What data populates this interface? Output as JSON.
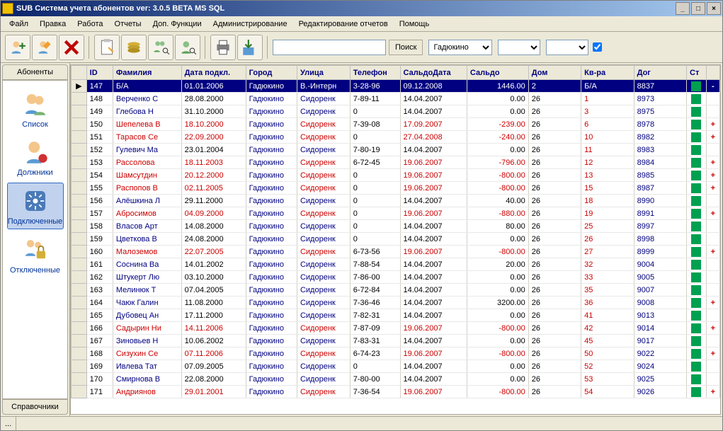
{
  "title": "SUB Система учета абонентов ver: 3.0.5 BETA MS SQL",
  "menu": [
    "Файл",
    "Правка",
    "Работа",
    "Отчеты",
    "Доп. Функции",
    "Администрирование",
    "Редактирование отчетов",
    "Помощь"
  ],
  "toolbar": {
    "search_btn": "Поиск",
    "combo1": "Гадюкино"
  },
  "sidebar": {
    "header": "Абоненты",
    "footer": "Справочники",
    "items": [
      {
        "label": "Список"
      },
      {
        "label": "Должники"
      },
      {
        "label": "Подключенные"
      },
      {
        "label": "Отключенные"
      }
    ]
  },
  "grid": {
    "headers": [
      "ID",
      "Фамилия",
      "Дата подкл.",
      "Город",
      "Улица",
      "Телефон",
      "СальдоДата",
      "Сальдо",
      "Дом",
      "Кв-ра",
      "Дог",
      "Ст"
    ],
    "rows": [
      {
        "id": "147",
        "fam": "Б/А",
        "date": "01.01.2006",
        "city": "Гадюкино",
        "street": "В.-Интерн",
        "phone": "3-28-96",
        "sdate": "09.12.2008",
        "saldo": "1446.00",
        "house": "2",
        "flat": "Б/А",
        "dog": "8837",
        "neg": false,
        "flag": "-",
        "sel": true
      },
      {
        "id": "148",
        "fam": "Верченко С",
        "date": "28.08.2000",
        "city": "Гадюкино",
        "street": "Сидоренк",
        "phone": "7-89-11",
        "sdate": "14.04.2007",
        "saldo": "0.00",
        "house": "26",
        "flat": "1",
        "dog": "8973",
        "neg": false,
        "flag": ""
      },
      {
        "id": "149",
        "fam": "Глебова Н",
        "date": "31.10.2000",
        "city": "Гадюкино",
        "street": "Сидоренк",
        "phone": "0",
        "sdate": "14.04.2007",
        "saldo": "0.00",
        "house": "26",
        "flat": "3",
        "dog": "8975",
        "neg": false,
        "flag": ""
      },
      {
        "id": "150",
        "fam": "Шепелева В",
        "date": "18.10.2000",
        "city": "Гадюкино",
        "street": "Сидоренк",
        "phone": "7-39-08",
        "sdate": "17.09.2007",
        "saldo": "-239.00",
        "house": "26",
        "flat": "6",
        "dog": "8978",
        "neg": true,
        "flag": "+"
      },
      {
        "id": "151",
        "fam": "Тарасов Се",
        "date": "22.09.2000",
        "city": "Гадюкино",
        "street": "Сидоренк",
        "phone": "0",
        "sdate": "27.04.2008",
        "saldo": "-240.00",
        "house": "26",
        "flat": "10",
        "dog": "8982",
        "neg": true,
        "flag": "+"
      },
      {
        "id": "152",
        "fam": "Гулевич Ма",
        "date": "23.01.2004",
        "city": "Гадюкино",
        "street": "Сидоренк",
        "phone": "7-80-19",
        "sdate": "14.04.2007",
        "saldo": "0.00",
        "house": "26",
        "flat": "11",
        "dog": "8983",
        "neg": false,
        "flag": ""
      },
      {
        "id": "153",
        "fam": "Рассолова",
        "date": "18.11.2003",
        "city": "Гадюкино",
        "street": "Сидоренк",
        "phone": "6-72-45",
        "sdate": "19.06.2007",
        "saldo": "-796.00",
        "house": "26",
        "flat": "12",
        "dog": "8984",
        "neg": true,
        "flag": "+"
      },
      {
        "id": "154",
        "fam": "Шамсутдин",
        "date": "20.12.2000",
        "city": "Гадюкино",
        "street": "Сидоренк",
        "phone": "0",
        "sdate": "19.06.2007",
        "saldo": "-800.00",
        "house": "26",
        "flat": "13",
        "dog": "8985",
        "neg": true,
        "flag": "+"
      },
      {
        "id": "155",
        "fam": "Распопов В",
        "date": "02.11.2005",
        "city": "Гадюкино",
        "street": "Сидоренк",
        "phone": "0",
        "sdate": "19.06.2007",
        "saldo": "-800.00",
        "house": "26",
        "flat": "15",
        "dog": "8987",
        "neg": true,
        "flag": "+"
      },
      {
        "id": "156",
        "fam": "Алёшкина Л",
        "date": "29.11.2000",
        "city": "Гадюкино",
        "street": "Сидоренк",
        "phone": "0",
        "sdate": "14.04.2007",
        "saldo": "40.00",
        "house": "26",
        "flat": "18",
        "dog": "8990",
        "neg": false,
        "flag": ""
      },
      {
        "id": "157",
        "fam": "Абросимов",
        "date": "04.09.2000",
        "city": "Гадюкино",
        "street": "Сидоренк",
        "phone": "0",
        "sdate": "19.06.2007",
        "saldo": "-880.00",
        "house": "26",
        "flat": "19",
        "dog": "8991",
        "neg": true,
        "flag": "+"
      },
      {
        "id": "158",
        "fam": "Власов Арт",
        "date": "14.08.2000",
        "city": "Гадюкино",
        "street": "Сидоренк",
        "phone": "0",
        "sdate": "14.04.2007",
        "saldo": "80.00",
        "house": "26",
        "flat": "25",
        "dog": "8997",
        "neg": false,
        "flag": ""
      },
      {
        "id": "159",
        "fam": "Цветкова В",
        "date": "24.08.2000",
        "city": "Гадюкино",
        "street": "Сидоренк",
        "phone": "0",
        "sdate": "14.04.2007",
        "saldo": "0.00",
        "house": "26",
        "flat": "26",
        "dog": "8998",
        "neg": false,
        "flag": ""
      },
      {
        "id": "160",
        "fam": "Малоземов",
        "date": "22.07.2005",
        "city": "Гадюкино",
        "street": "Сидоренк",
        "phone": "6-73-56",
        "sdate": "19.06.2007",
        "saldo": "-800.00",
        "house": "26",
        "flat": "27",
        "dog": "8999",
        "neg": true,
        "flag": "+"
      },
      {
        "id": "161",
        "fam": "Соснина Ва",
        "date": "14.01.2002",
        "city": "Гадюкино",
        "street": "Сидоренк",
        "phone": "7-88-54",
        "sdate": "14.04.2007",
        "saldo": "20.00",
        "house": "26",
        "flat": "32",
        "dog": "9004",
        "neg": false,
        "flag": ""
      },
      {
        "id": "162",
        "fam": "Штукерт Лю",
        "date": "03.10.2000",
        "city": "Гадюкино",
        "street": "Сидоренк",
        "phone": "7-86-00",
        "sdate": "14.04.2007",
        "saldo": "0.00",
        "house": "26",
        "flat": "33",
        "dog": "9005",
        "neg": false,
        "flag": ""
      },
      {
        "id": "163",
        "fam": "Мелинюк Т",
        "date": "07.04.2005",
        "city": "Гадюкино",
        "street": "Сидоренк",
        "phone": "6-72-84",
        "sdate": "14.04.2007",
        "saldo": "0.00",
        "house": "26",
        "flat": "35",
        "dog": "9007",
        "neg": false,
        "flag": ""
      },
      {
        "id": "164",
        "fam": "Чаюк Галин",
        "date": "11.08.2000",
        "city": "Гадюкино",
        "street": "Сидоренк",
        "phone": "7-36-46",
        "sdate": "14.04.2007",
        "saldo": "3200.00",
        "house": "26",
        "flat": "36",
        "dog": "9008",
        "neg": false,
        "flag": "+"
      },
      {
        "id": "165",
        "fam": "Дубовец Ан",
        "date": "17.11.2000",
        "city": "Гадюкино",
        "street": "Сидоренк",
        "phone": "7-82-31",
        "sdate": "14.04.2007",
        "saldo": "0.00",
        "house": "26",
        "flat": "41",
        "dog": "9013",
        "neg": false,
        "flag": ""
      },
      {
        "id": "166",
        "fam": "Садырин Ни",
        "date": "14.11.2006",
        "city": "Гадюкино",
        "street": "Сидоренк",
        "phone": "7-87-09",
        "sdate": "19.06.2007",
        "saldo": "-800.00",
        "house": "26",
        "flat": "42",
        "dog": "9014",
        "neg": true,
        "flag": "+"
      },
      {
        "id": "167",
        "fam": "Зиновьев Н",
        "date": "10.06.2002",
        "city": "Гадюкино",
        "street": "Сидоренк",
        "phone": "7-83-31",
        "sdate": "14.04.2007",
        "saldo": "0.00",
        "house": "26",
        "flat": "45",
        "dog": "9017",
        "neg": false,
        "flag": ""
      },
      {
        "id": "168",
        "fam": "Сизухин Се",
        "date": "07.11.2006",
        "city": "Гадюкино",
        "street": "Сидоренк",
        "phone": "6-74-23",
        "sdate": "19.06.2007",
        "saldo": "-800.00",
        "house": "26",
        "flat": "50",
        "dog": "9022",
        "neg": true,
        "flag": "+"
      },
      {
        "id": "169",
        "fam": "Ивлева Тат",
        "date": "07.09.2005",
        "city": "Гадюкино",
        "street": "Сидоренк",
        "phone": "0",
        "sdate": "14.04.2007",
        "saldo": "0.00",
        "house": "26",
        "flat": "52",
        "dog": "9024",
        "neg": false,
        "flag": ""
      },
      {
        "id": "170",
        "fam": "Смирнова В",
        "date": "22.08.2000",
        "city": "Гадюкино",
        "street": "Сидоренк",
        "phone": "7-80-00",
        "sdate": "14.04.2007",
        "saldo": "0.00",
        "house": "26",
        "flat": "53",
        "dog": "9025",
        "neg": false,
        "flag": ""
      },
      {
        "id": "171",
        "fam": "Андриянов",
        "date": "29.01.2001",
        "city": "Гадюкино",
        "street": "Сидоренк",
        "phone": "7-36-54",
        "sdate": "19.06.2007",
        "saldo": "-800.00",
        "house": "26",
        "flat": "54",
        "dog": "9026",
        "neg": true,
        "flag": "+"
      }
    ]
  },
  "statusbar": "..."
}
